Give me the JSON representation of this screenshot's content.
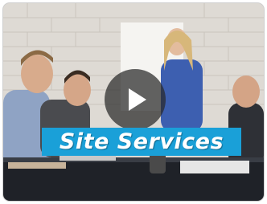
{
  "video": {
    "caption": "Site Services",
    "play_icon": "play-icon",
    "colors": {
      "caption_bg": "#1aa0d8",
      "caption_text": "#ffffff",
      "play_bg": "#282828"
    }
  }
}
